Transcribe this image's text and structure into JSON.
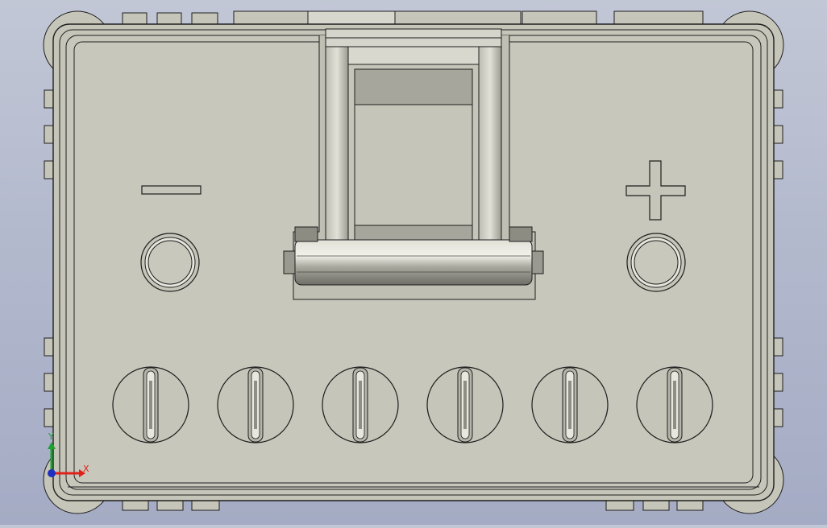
{
  "viewport": {
    "background_top": "#c2c7d6",
    "background_bottom": "#a4abc4"
  },
  "model": {
    "body_color": "#c6c5b9",
    "outline_color": "#1e1e1e",
    "negative_terminal_symbol": "minus",
    "positive_terminal_symbol": "plus",
    "terminal_count": 2,
    "vent_cap_count": 6
  },
  "triad": {
    "x_label": "X",
    "y_label": "Y",
    "x_color": "#e0201a",
    "y_color": "#20a030",
    "z_color": "#2030c0"
  }
}
